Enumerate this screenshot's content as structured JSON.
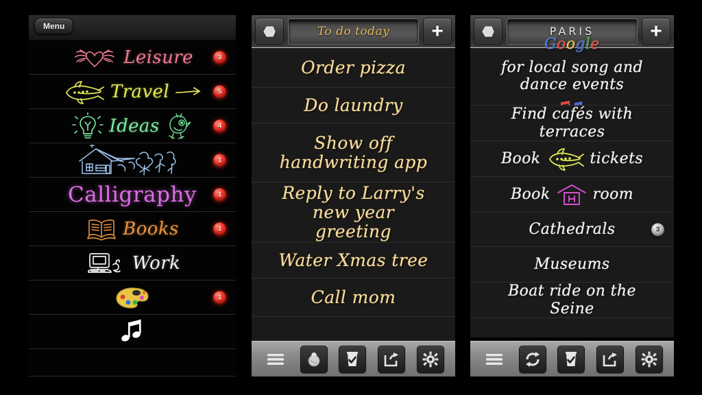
{
  "app": {
    "background_color": "#000000",
    "panel_count": 3
  },
  "panel_categories": {
    "menu_label": "Menu",
    "rows": [
      {
        "label": "Leisure",
        "icon": "winged-heart-icon",
        "color": "#e8798f",
        "badge": "3"
      },
      {
        "label": "Travel",
        "icon": "airplane-icon",
        "color": "#e2e857",
        "badge": "5"
      },
      {
        "label": "Ideas",
        "icon": "lightbulb-icon",
        "color": "#7fe8a0",
        "badge": "4"
      },
      {
        "label": "",
        "icon": "house-tree-icon",
        "color": "#9fc4ee",
        "badge": "1"
      },
      {
        "label": "Calligraphy",
        "icon": "",
        "color": "#d96fe0",
        "badge": "1"
      },
      {
        "label": "Books",
        "icon": "open-book-icon",
        "color": "#e8913f",
        "badge": "1"
      },
      {
        "label": "Work",
        "icon": "computer-icon",
        "color": "#f2f2f2",
        "badge": ""
      },
      {
        "label": "",
        "icon": "paint-palette-icon",
        "color": "#f0c44a",
        "badge": "1"
      },
      {
        "label": "",
        "icon": "music-note-icon",
        "color": "#ffffff",
        "badge": ""
      },
      {
        "label": "",
        "icon": "",
        "color": "#ffffff",
        "badge": ""
      }
    ]
  },
  "panel_todo": {
    "title": "To do today",
    "back_icon": "back-arrow-icon",
    "add_icon": "plus-icon",
    "text_color": "#f5dca0",
    "items": [
      {
        "text": "Order pizza"
      },
      {
        "text": "Do laundry"
      },
      {
        "text": "Show off handwriting app"
      },
      {
        "text": "Reply to Larry's new year greeting"
      },
      {
        "text": "Water Xmas tree"
      },
      {
        "text": "Call mom"
      },
      {
        "text": ""
      }
    ],
    "toolbar": [
      {
        "icon": "list-menu-icon",
        "label": "List"
      },
      {
        "icon": "eraser-icon",
        "label": "Eraser"
      },
      {
        "icon": "trash-check-icon",
        "label": "Delete"
      },
      {
        "icon": "share-icon",
        "label": "Share"
      },
      {
        "icon": "settings-gear-icon",
        "label": "Settings"
      }
    ]
  },
  "panel_paris": {
    "title": "PARIS",
    "back_icon": "back-arrow-icon",
    "add_icon": "plus-icon",
    "text_color": "#f4f4f4",
    "items": [
      {
        "text_before": "",
        "brand": "Google",
        "brand_letters": [
          {
            "ch": "G",
            "color": "#4a6fe3"
          },
          {
            "ch": "o",
            "color": "#e04b3c"
          },
          {
            "ch": "o",
            "color": "#edc73a"
          },
          {
            "ch": "g",
            "color": "#4a6fe3"
          },
          {
            "ch": "l",
            "color": "#3fb24a"
          },
          {
            "ch": "e",
            "color": "#e04b3c"
          }
        ],
        "text_after": "for local song and dance events",
        "trailing_icon": "music-notes-icon",
        "badge": ""
      },
      {
        "text_after": "Find cafés with terraces",
        "badge": ""
      },
      {
        "text_before": "Book",
        "inline_icon": "airplane-icon",
        "text_after": "tickets",
        "badge": ""
      },
      {
        "text_before": "Book",
        "inline_icon": "hotel-icon",
        "text_after": "room",
        "badge": ""
      },
      {
        "text_after": "Cathedrals",
        "badge": "3"
      },
      {
        "text_after": "Museums",
        "badge": ""
      },
      {
        "text_after": "Boat ride on the Seine",
        "badge": ""
      },
      {
        "text_after": "",
        "badge": ""
      }
    ],
    "toolbar": [
      {
        "icon": "list-menu-icon",
        "label": "List"
      },
      {
        "icon": "sync-refresh-icon",
        "label": "Sync"
      },
      {
        "icon": "trash-check-icon",
        "label": "Delete"
      },
      {
        "icon": "share-icon",
        "label": "Share"
      },
      {
        "icon": "settings-gear-icon",
        "label": "Settings"
      }
    ]
  },
  "colors": {
    "badge_red": "#f03024",
    "badge_gray": "#b8b8b8",
    "toolbar_bg": "#8d8d8d",
    "row_bg_dark": "#1a1a1a"
  }
}
